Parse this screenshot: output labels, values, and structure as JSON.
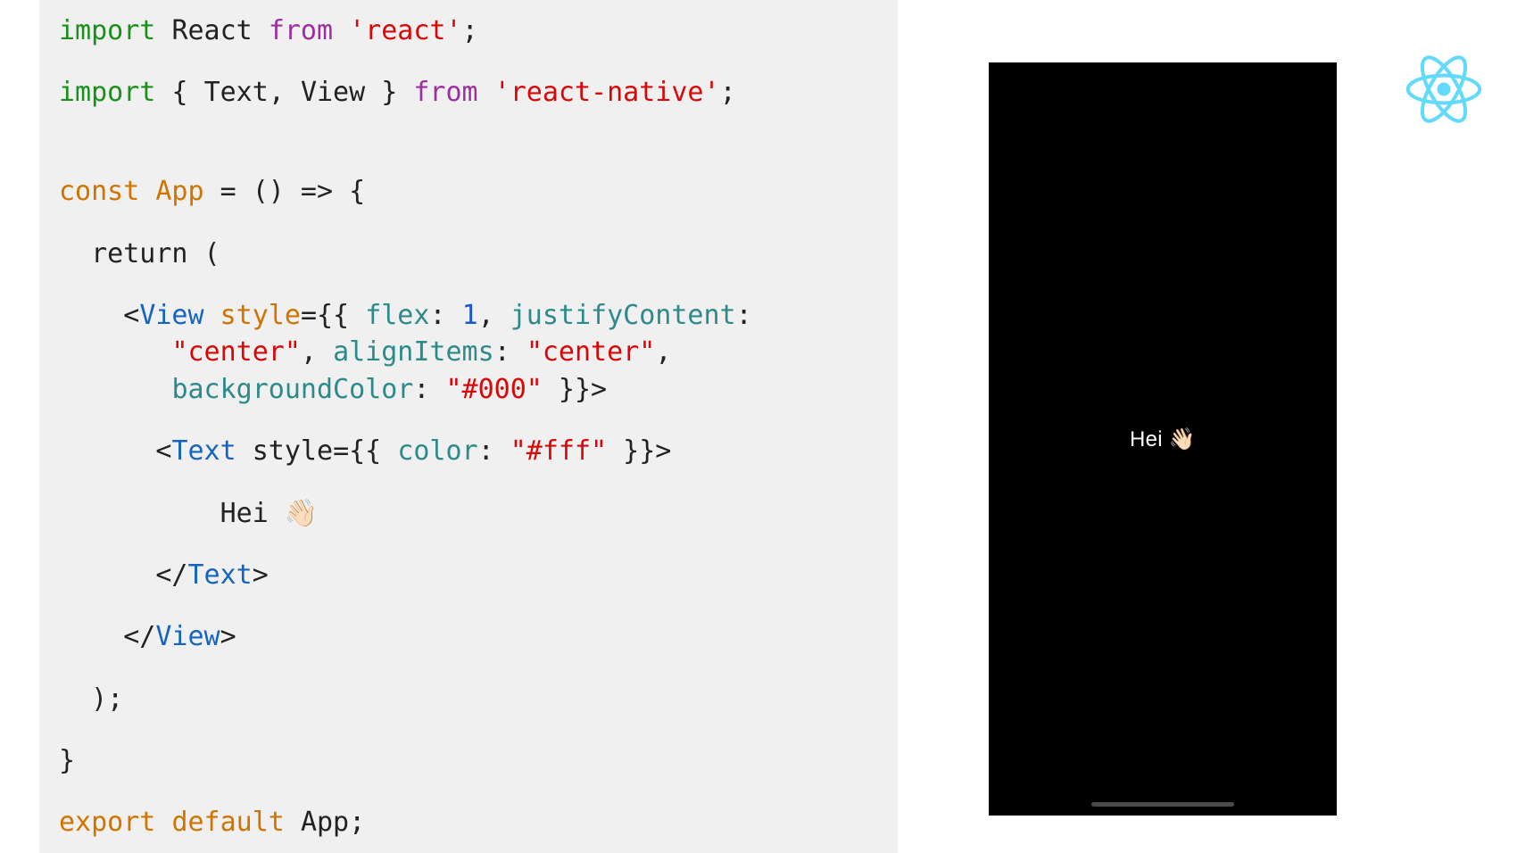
{
  "code": {
    "line1": {
      "import": "import",
      "react": "React",
      "from": "from",
      "mod": "'react'",
      "semi": ";"
    },
    "line2": {
      "import": "import",
      "brace_o": "{ ",
      "text": "Text",
      "comma": ", ",
      "view": "View",
      "brace_c": " }",
      "from": "from",
      "mod": "'react-native'",
      "semi": ";"
    },
    "line3": {
      "const": "const",
      "app": "App",
      "eq_arrow": " = () => {"
    },
    "line4": {
      "return": "  return ("
    },
    "line5a": {
      "lt": "    <",
      "tag": "View",
      "sp": " ",
      "style": "style",
      "eq": "={{ ",
      "k1": "flex",
      "c1": ": ",
      "v1": "1",
      "c2": ", ",
      "k2": "justifyContent",
      "c3": ":"
    },
    "line5b": {
      "indent": "       ",
      "v2": "\"center\"",
      "c4": ", ",
      "k3": "alignItems",
      "c5": ": ",
      "v3": "\"center\"",
      "c6": ","
    },
    "line5c": {
      "indent": "       ",
      "k4": "backgroundColor",
      "c7": ": ",
      "v4": "\"#000\"",
      "close": " }}>"
    },
    "line6": {
      "indent": "      <",
      "tag": "Text",
      "sp": " ",
      "style": "style",
      "eq": "={{ ",
      "k1": "color",
      "c1": ": ",
      "v1": "\"#fff\"",
      "close": " }}>"
    },
    "line7": {
      "indent": "          ",
      "content": "Hei 👋🏻"
    },
    "line8": {
      "indent": "      </",
      "tag": "Text",
      "gt": ">"
    },
    "line9": {
      "indent": "    </",
      "tag": "View",
      "gt": ">"
    },
    "line10": {
      "text": "  );"
    },
    "line11": {
      "text": "}"
    },
    "line12": {
      "export": "export",
      "default": "default",
      "app": "App",
      "semi": ";"
    }
  },
  "phone": {
    "text": "Hei 👋🏻"
  },
  "logo": {
    "name": "react-icon",
    "color": "#61dafb"
  }
}
